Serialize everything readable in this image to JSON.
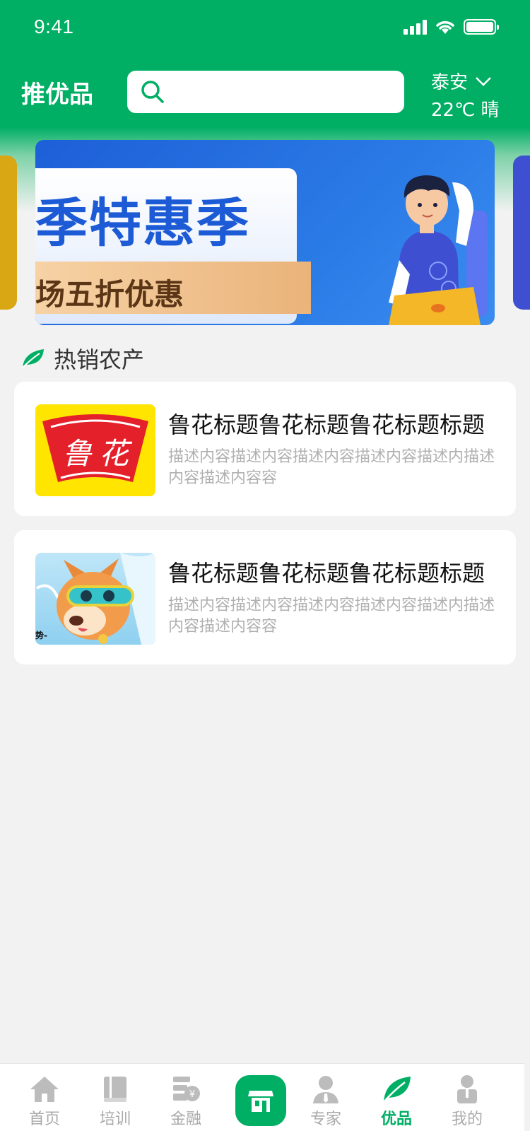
{
  "status_bar": {
    "time": "9:41"
  },
  "header": {
    "title": "推优品",
    "search": {
      "value": "",
      "placeholder": ""
    },
    "location": {
      "city": "泰安",
      "weather": "22℃ 晴"
    }
  },
  "banner": {
    "title": "季特惠季",
    "subtitle": "场五折优惠"
  },
  "section": {
    "title": "热销农产"
  },
  "products": [
    {
      "title": "鲁花标题鲁花标题鲁花标题标题",
      "description": "描述内容描述内容描述内容描述内容描述内描述内容描述内容容",
      "image_text": "鲁花",
      "image_bg": "#ffe500",
      "image_accent": "#e4202a"
    },
    {
      "title": "鲁花标题鲁花标题鲁花标题标题",
      "description": "描述内容描述内容描述内容描述内容描述内描述内容描述内容容",
      "image_caption": "势-",
      "image_bg": "#a9ddf5"
    }
  ],
  "tabbar": {
    "items": [
      {
        "label": "首页",
        "icon": "home-icon"
      },
      {
        "label": "培训",
        "icon": "book-icon"
      },
      {
        "label": "金融",
        "icon": "finance-icon"
      },
      {
        "label": "",
        "icon": "store-icon"
      },
      {
        "label": "专家",
        "icon": "expert-icon"
      },
      {
        "label": "优品",
        "icon": "leaf-icon",
        "active": true
      },
      {
        "label": "我的",
        "icon": "user-icon"
      }
    ]
  },
  "colors": {
    "primary": "#00ae64",
    "background": "#f2f2f2",
    "muted_text": "#b0b0b0",
    "inactive_tab": "#aaaaaa"
  }
}
